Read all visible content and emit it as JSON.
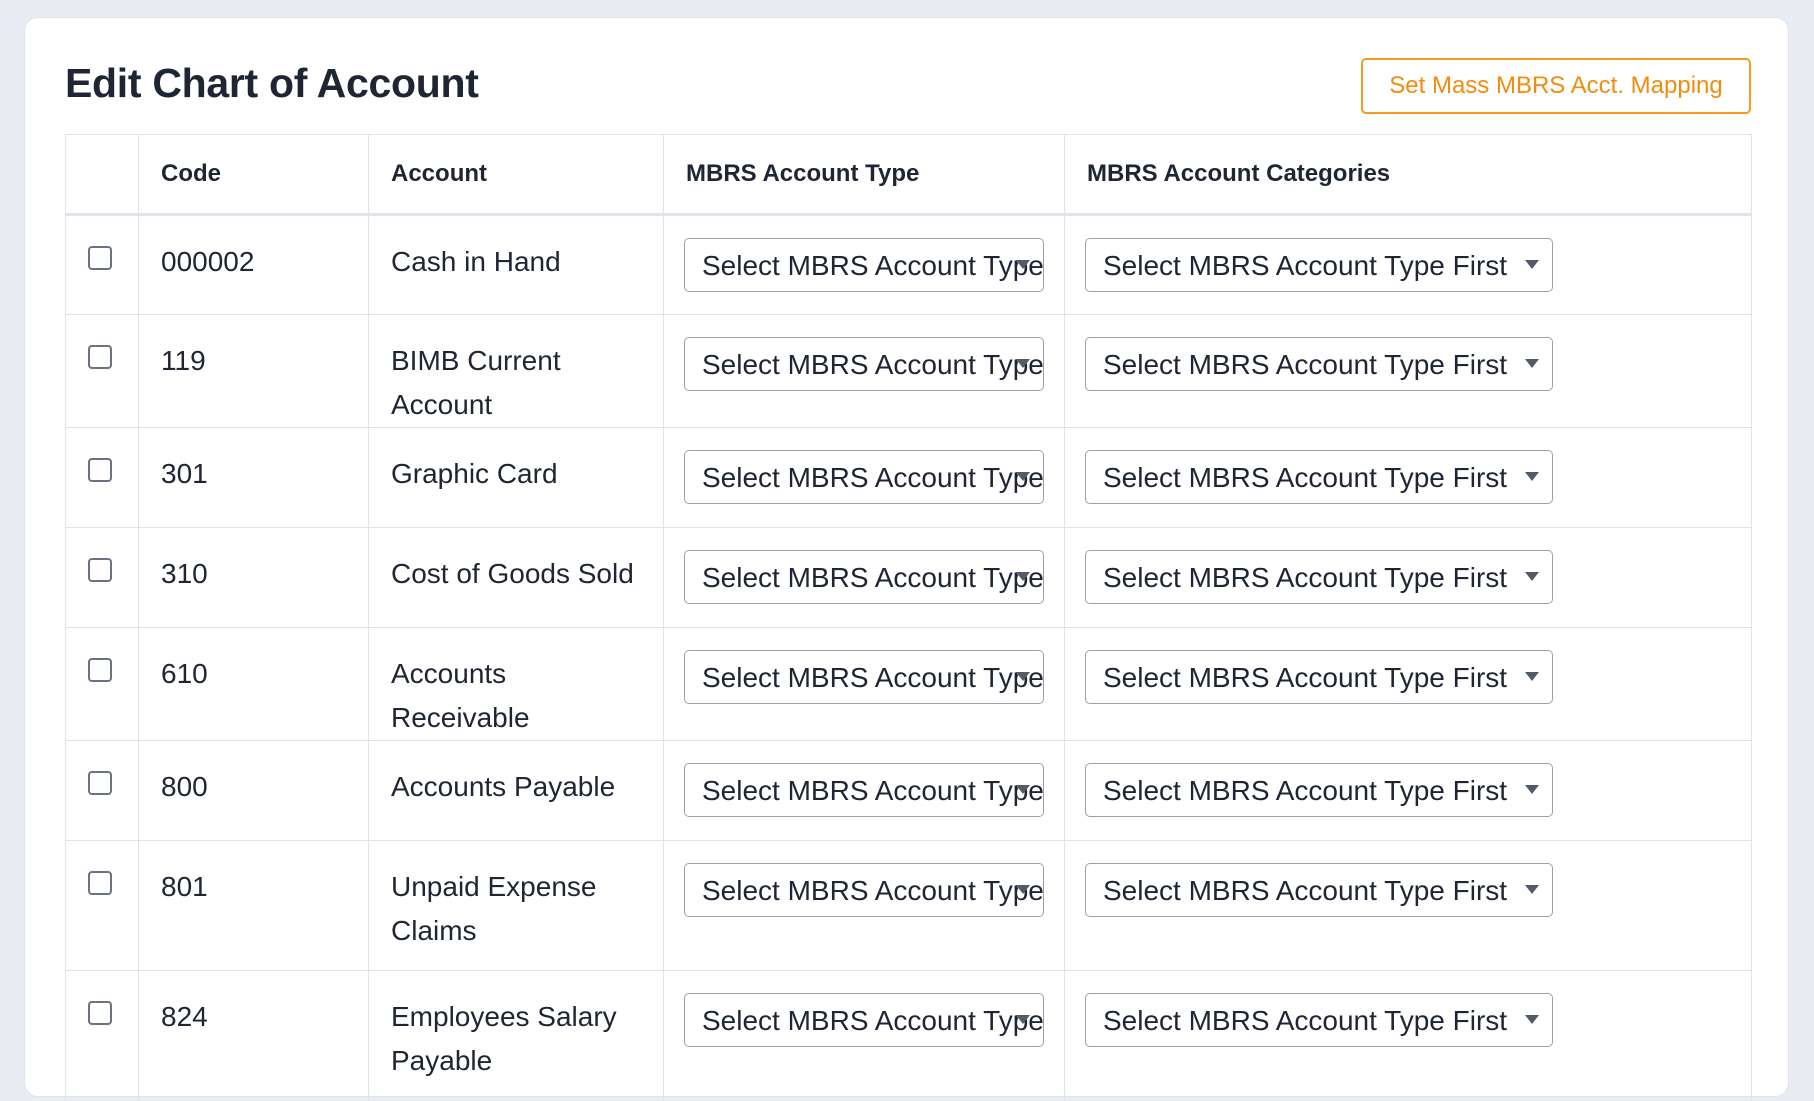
{
  "page": {
    "title": "Edit Chart of Account",
    "mass_mapping_button": "Set Mass MBRS Acct. Mapping"
  },
  "table": {
    "headers": {
      "select": "",
      "code": "Code",
      "account": "Account",
      "type": "MBRS Account Type",
      "categories": "MBRS Account Categories"
    },
    "rows": [
      {
        "code": "000002",
        "account": "Cash in Hand",
        "type_select": "Select MBRS Account Type",
        "category_select": "Select MBRS Account Type First",
        "checked": false
      },
      {
        "code": "119",
        "account": "BIMB Current Account",
        "type_select": "Select MBRS Account Type",
        "category_select": "Select MBRS Account Type First",
        "checked": false
      },
      {
        "code": "301",
        "account": "Graphic Card",
        "type_select": "Select MBRS Account Type",
        "category_select": "Select MBRS Account Type First",
        "checked": false
      },
      {
        "code": "310",
        "account": "Cost of Goods Sold",
        "type_select": "Select MBRS Account Type",
        "category_select": "Select MBRS Account Type First",
        "checked": false
      },
      {
        "code": "610",
        "account": "Accounts Receivable",
        "type_select": "Select MBRS Account Type",
        "category_select": "Select MBRS Account Type First",
        "checked": false
      },
      {
        "code": "800",
        "account": "Accounts Payable",
        "type_select": "Select MBRS Account Type",
        "category_select": "Select MBRS Account Type First",
        "checked": false
      },
      {
        "code": "801",
        "account": "Unpaid Expense Claims",
        "type_select": "Select MBRS Account Type",
        "category_select": "Select MBRS Account Type First",
        "checked": false
      },
      {
        "code": "824",
        "account": "Employees Salary Payable",
        "type_select": "Select MBRS Account Type",
        "category_select": "Select MBRS Account Type First",
        "checked": false
      }
    ]
  },
  "colors": {
    "accent": "#f28c0d",
    "background": "#e9ecf3",
    "border": "#dfe3ec"
  }
}
